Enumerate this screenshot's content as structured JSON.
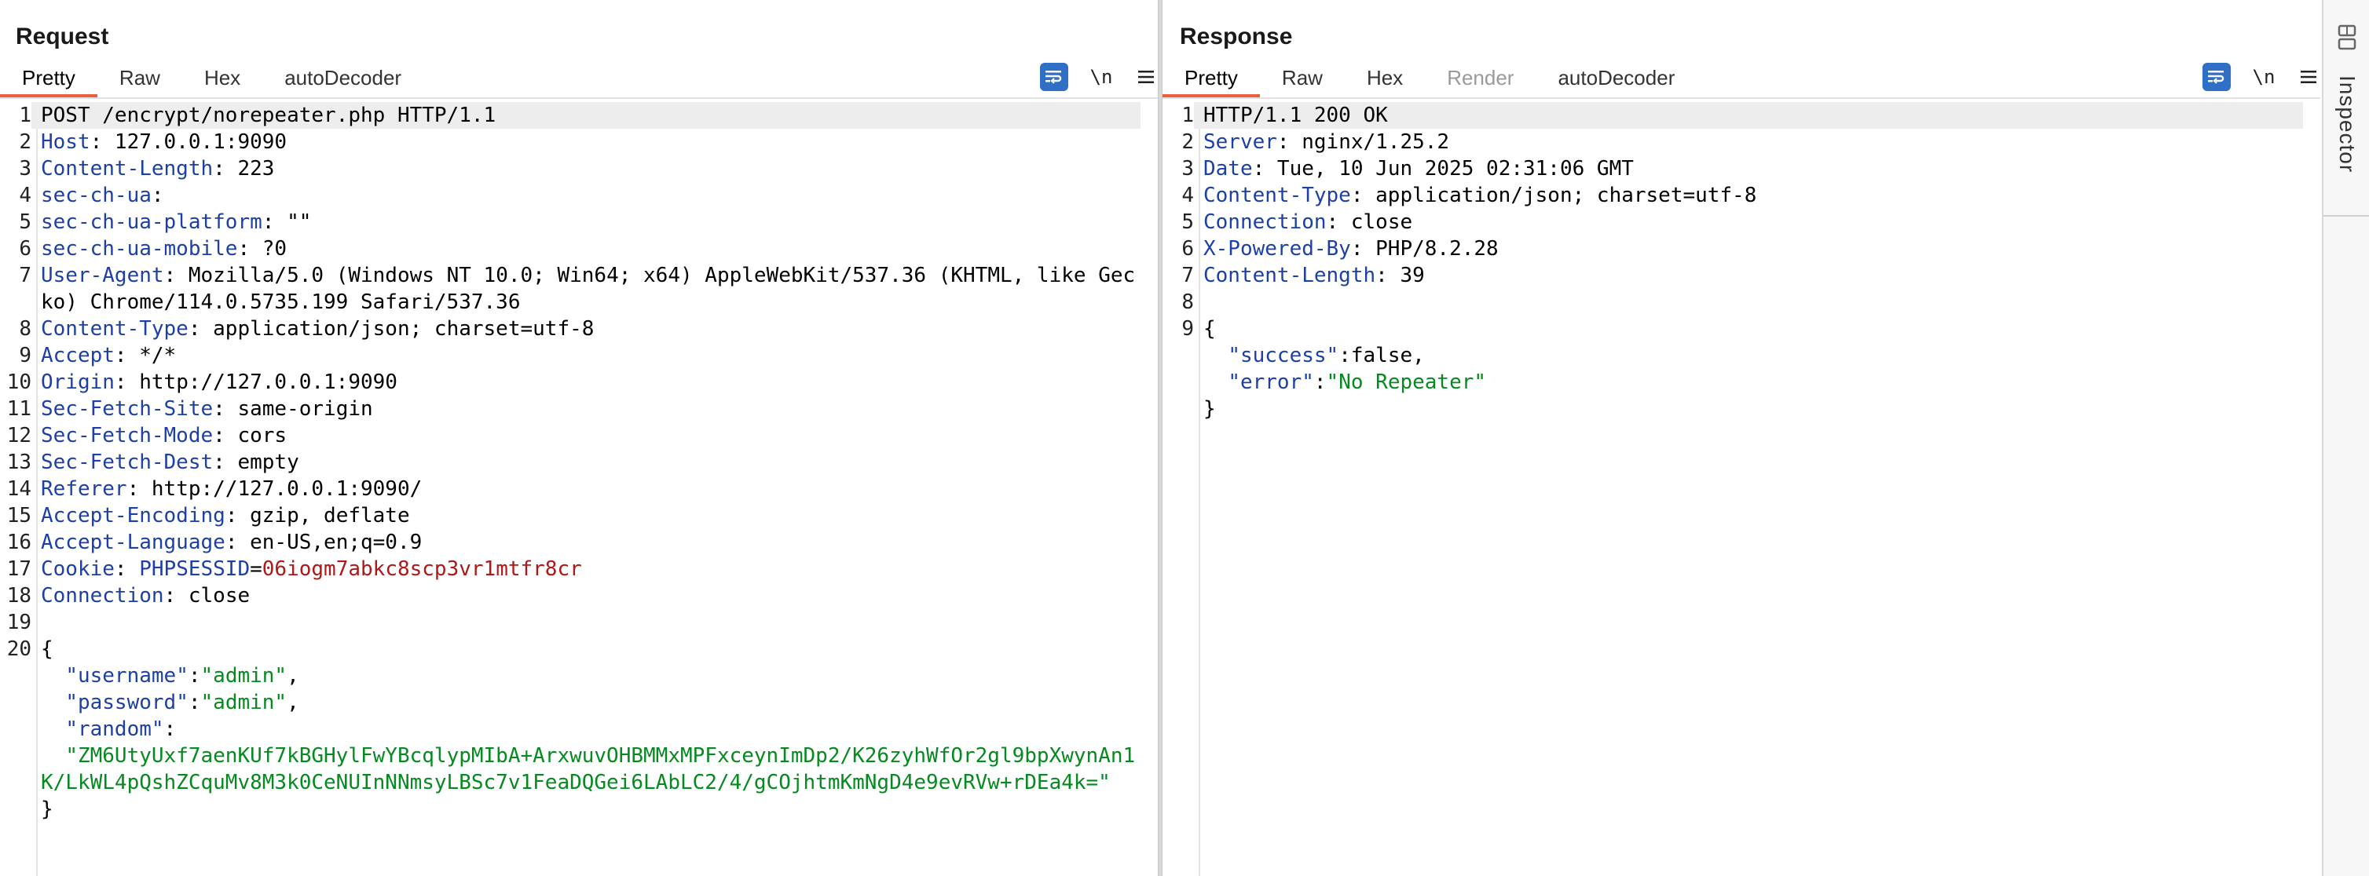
{
  "request": {
    "title": "Request",
    "tabs": [
      "Pretty",
      "Raw",
      "Hex",
      "autoDecoder"
    ],
    "active_tab": "Pretty",
    "newline_label": "\\n",
    "lines": [
      {
        "n": "1",
        "text": "POST /encrypt/norepeater.php HTTP/1.1"
      },
      {
        "n": "2",
        "name": "Host",
        "value": " 127.0.0.1:9090"
      },
      {
        "n": "3",
        "name": "Content-Length",
        "value": " 223"
      },
      {
        "n": "4",
        "name": "sec-ch-ua",
        "value": ""
      },
      {
        "n": "5",
        "name": "sec-ch-ua-platform",
        "value": " \"\""
      },
      {
        "n": "6",
        "name": "sec-ch-ua-mobile",
        "value": " ?0"
      },
      {
        "n": "7",
        "name": "User-Agent",
        "value": " Mozilla/5.0 (Windows NT 10.0; Win64; x64) AppleWebKit/537.36 (KHTML, like Gecko) Chrome/114.0.5735.199 Safari/537.36"
      },
      {
        "n": "8",
        "name": "Content-Type",
        "value": " application/json; charset=utf-8"
      },
      {
        "n": "9",
        "name": "Accept",
        "value": " */*"
      },
      {
        "n": "10",
        "name": "Origin",
        "value": " http://127.0.0.1:9090"
      },
      {
        "n": "11",
        "name": "Sec-Fetch-Site",
        "value": " same-origin"
      },
      {
        "n": "12",
        "name": "Sec-Fetch-Mode",
        "value": " cors"
      },
      {
        "n": "13",
        "name": "Sec-Fetch-Dest",
        "value": " empty"
      },
      {
        "n": "14",
        "name": "Referer",
        "value": " http://127.0.0.1:9090/"
      },
      {
        "n": "15",
        "name": "Accept-Encoding",
        "value": " gzip, deflate"
      },
      {
        "n": "16",
        "name": "Accept-Language",
        "value": " en-US,en;q=0.9"
      },
      {
        "n": "17",
        "cookie": true,
        "name": "Cookie",
        "cookie_name": "PHPSESSID",
        "cookie_value": "06iogm7abkc8scp3vr1mtfr8cr"
      },
      {
        "n": "18",
        "name": "Connection",
        "value": " close"
      },
      {
        "n": "19",
        "text": ""
      },
      {
        "n": "20",
        "text": "{"
      },
      {
        "n": "",
        "key": "  \"username\"",
        "colon": ":",
        "val": "\"admin\"",
        "tail": ","
      },
      {
        "n": "",
        "key": "  \"password\"",
        "colon": ":",
        "val": "\"admin\"",
        "tail": ","
      },
      {
        "n": "",
        "key": "  \"random\"",
        "colon": ":",
        "val": "",
        "tail": ""
      },
      {
        "n": "",
        "indent_str": "  ",
        "val": "\"ZM6UtyUxf7aenKUf7kBGHylFwYBcqlypMIbA+ArxwuvOHBMMxMPFxceynImDp2/K26zyhWfOr2gl9bpXwynAn1K/LkWL4pQshZCquMv8M3k0CeNUInNNmsyLBSc7v1FeaDQGei6LAbLC2/4/gCOjhtmKmNgD4e9evRVw+rDEa4k=\""
      },
      {
        "n": "",
        "text": "}"
      }
    ]
  },
  "response": {
    "title": "Response",
    "tabs": [
      "Pretty",
      "Raw",
      "Hex",
      "Render",
      "autoDecoder"
    ],
    "active_tab": "Pretty",
    "newline_label": "\\n",
    "lines": [
      {
        "n": "1",
        "text": "HTTP/1.1 200 OK"
      },
      {
        "n": "2",
        "name": "Server",
        "value": " nginx/1.25.2"
      },
      {
        "n": "3",
        "name": "Date",
        "value": " Tue, 10 Jun 2025 02:31:06 GMT"
      },
      {
        "n": "4",
        "name": "Content-Type",
        "value": " application/json; charset=utf-8"
      },
      {
        "n": "5",
        "name": "Connection",
        "value": " close"
      },
      {
        "n": "6",
        "name": "X-Powered-By",
        "value": " PHP/8.2.28"
      },
      {
        "n": "7",
        "name": "Content-Length",
        "value": " 39"
      },
      {
        "n": "8",
        "text": ""
      },
      {
        "n": "9",
        "text": "{"
      },
      {
        "n": "",
        "key": "  \"success\"",
        "colon": ":",
        "plain": "false",
        "tail": ","
      },
      {
        "n": "",
        "key": "  \"error\"",
        "colon": ":",
        "val": "\"No Repeater\"",
        "tail": ""
      },
      {
        "n": "",
        "text": "}"
      }
    ]
  },
  "sidebar": {
    "label": "Inspector",
    "icon": "inspector-icon"
  },
  "colors": {
    "accent": "#e8613c",
    "button_blue": "#2f6fc6",
    "header_name": "#1c3fa8",
    "string": "#058a1f",
    "cookie_value": "#b01717"
  }
}
